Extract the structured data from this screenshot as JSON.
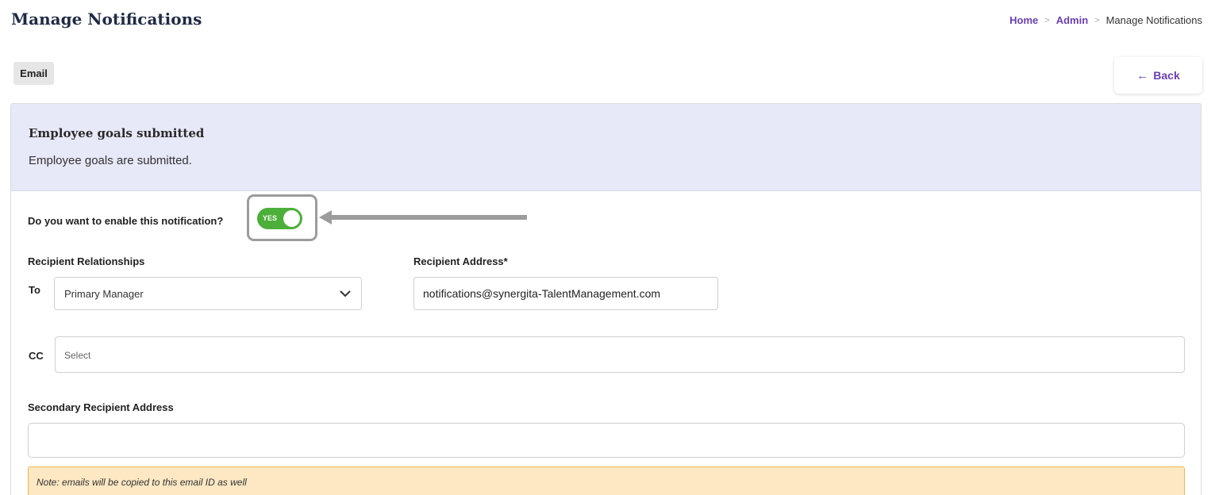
{
  "header": {
    "title": "Manage Notifications",
    "breadcrumb": {
      "home": "Home",
      "admin": "Admin",
      "current": "Manage Notifications"
    }
  },
  "tabs": {
    "email": "Email"
  },
  "back_button": {
    "icon": "arrow-left-icon",
    "label": "Back"
  },
  "notification": {
    "title": "Employee goals submitted",
    "description": "Employee goals are submitted."
  },
  "enable": {
    "question": "Do you want to enable this notification?",
    "toggle_label": "YES",
    "enabled": true
  },
  "form": {
    "recipient_relationships_label": "Recipient Relationships",
    "recipient_address_label": "Recipient Address*",
    "to_label": "To",
    "to_value": "Primary Manager",
    "recipient_address_value": "notifications@synergita-TalentManagement.com",
    "cc_label": "CC",
    "cc_placeholder": "Select",
    "secondary_label": "Secondary Recipient Address",
    "secondary_value": "",
    "note": "Note: emails will be copied to this email ID as well"
  },
  "colors": {
    "accent": "#6a3fb3",
    "toggle_on": "#4caf3a",
    "header_bg": "#e7e8f8",
    "note_bg": "#fde8c3",
    "note_border": "#f0b64a"
  }
}
